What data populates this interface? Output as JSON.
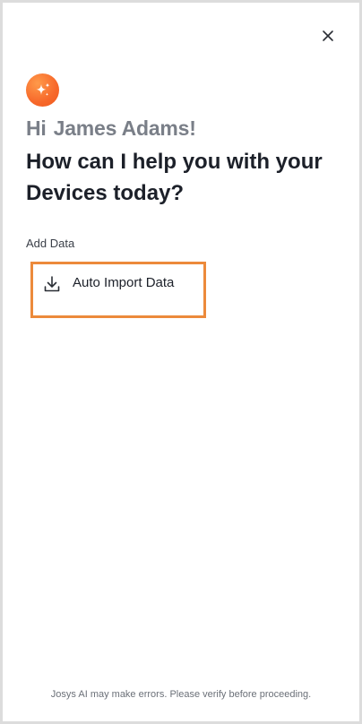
{
  "header": {
    "close_icon": "close-icon",
    "avatar_icon": "sparkle-icon",
    "avatar_color": "#f7682a"
  },
  "greeting": {
    "prefix": "Hi",
    "name": "James Adams!"
  },
  "headline": "How can I help you with your Devices today?",
  "section": {
    "label": "Add Data",
    "actions": [
      {
        "label": "Auto Import Data",
        "icon": "download-icon",
        "highlight_color": "#ec8a3b"
      }
    ]
  },
  "footer": {
    "disclaimer": "Josys AI may make errors. Please verify before proceeding."
  }
}
